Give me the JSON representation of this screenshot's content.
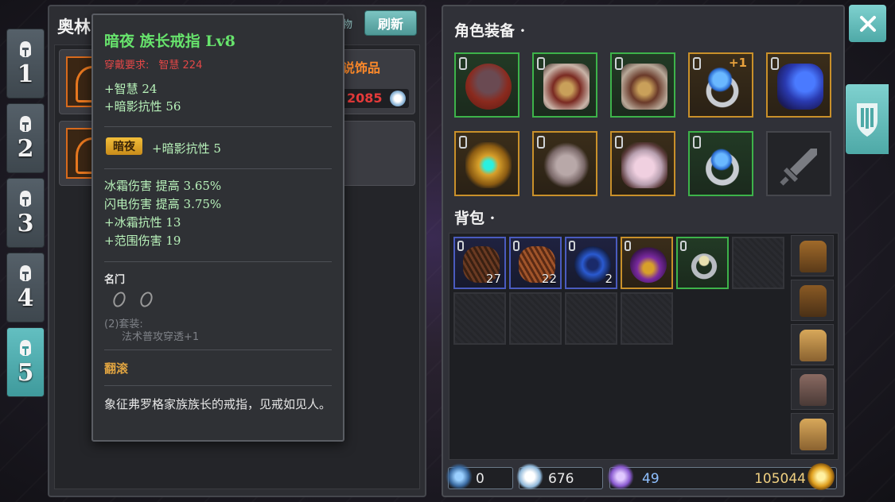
{
  "tabs": [
    "1",
    "2",
    "3",
    "4",
    "5"
  ],
  "active_tab": "5",
  "shop": {
    "title": "奥林",
    "tag": "物",
    "refresh_label": "刷新",
    "item_rarity_label": "说饰品",
    "price": "2085"
  },
  "tooltip": {
    "name": "暗夜 族长戒指 Lv8",
    "requirement_label": "穿戴要求:",
    "requirement_value": "智慧 224",
    "base_stats": [
      "+智慧 24",
      "+暗影抗性 56"
    ],
    "element_badge": "暗夜",
    "element_stat": "+暗影抗性 5",
    "extra_stats": [
      "冰霜伤害 提高 3.65%",
      "闪电伤害 提高 3.75%",
      "+冰霜抗性 13",
      "+范围伤害 19"
    ],
    "set_name": "名门",
    "set_bonus_label": "(2)套装:",
    "set_bonus_value": "法术普攻穿透+1",
    "roll_label": "翻滚",
    "lore": "象征弗罗格家族族长的戒指，见戒如见人。"
  },
  "equip": {
    "title": "角色装备 ·",
    "upgrade_badge": "+1"
  },
  "bag": {
    "title": "背包 ·",
    "counts": [
      "27",
      "22",
      "2"
    ]
  },
  "footer": {
    "weapon_value": "0",
    "gem_value": "676",
    "crystal_value": "49",
    "gold_value": "105044"
  },
  "colors": {
    "accent_teal": "#63bfc1",
    "rarity_green": "#3db34a",
    "rarity_gold": "#c9902a",
    "rarity_blue": "#4a5bbf",
    "name_green": "#67e36c",
    "requirement_red": "#e24747"
  }
}
